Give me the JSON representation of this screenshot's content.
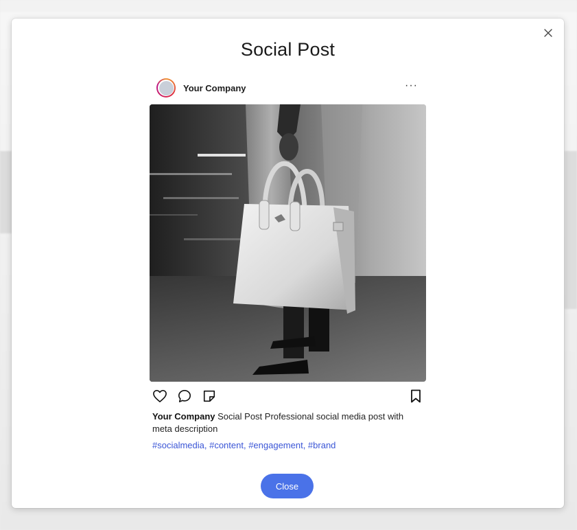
{
  "modal": {
    "title": "Social Post",
    "close_label": "Close"
  },
  "post": {
    "company_name": "Your Company",
    "more_label": "···",
    "caption_company": "Your Company",
    "caption_text": "Social Post Professional social media post with meta description",
    "hashtags": "#socialmedia, #content, #engagement, #brand",
    "image_subject": "black-and-white photo of a person holding a white leather tote bag"
  },
  "icons": {
    "close": "close-icon",
    "like": "heart-icon",
    "comment": "comment-icon",
    "share": "note-icon",
    "save": "bookmark-icon"
  },
  "colors": {
    "accent": "#4a72e8",
    "hashtag": "#3a55d6"
  }
}
